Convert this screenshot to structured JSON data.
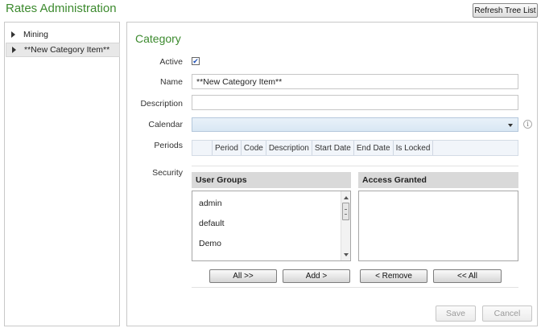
{
  "app": {
    "title": "Rates Administration",
    "refresh_label": "Refresh Tree List"
  },
  "tree": {
    "items": [
      {
        "label": "Mining"
      },
      {
        "label": "**New Category Item**"
      }
    ]
  },
  "form": {
    "section_title": "Category",
    "active_label": "Active",
    "active_checked": true,
    "name_label": "Name",
    "name_value": "**New Category Item**",
    "description_label": "Description",
    "description_value": "",
    "calendar_label": "Calendar",
    "calendar_value": "",
    "periods_label": "Periods",
    "periods_columns": [
      "Period",
      "Code",
      "Description",
      "Start Date",
      "End Date",
      "Is Locked"
    ],
    "security_label": "Security"
  },
  "security": {
    "user_groups_header": "User Groups",
    "access_granted_header": "Access Granted",
    "user_groups": [
      "admin",
      "default",
      "Demo"
    ],
    "access_granted": [],
    "buttons": {
      "all_right": "All >>",
      "add": "Add >",
      "remove": "< Remove",
      "all_left": "<< All"
    }
  },
  "footer": {
    "save_label": "Save",
    "cancel_label": "Cancel"
  },
  "colors": {
    "accent_green": "#3c8a2e",
    "header_gray": "#d9d9d9",
    "combo_blue": "#dde9f5"
  },
  "icons": {
    "calendar_info": "info-icon",
    "tree_expander": "triangle-right-icon"
  }
}
